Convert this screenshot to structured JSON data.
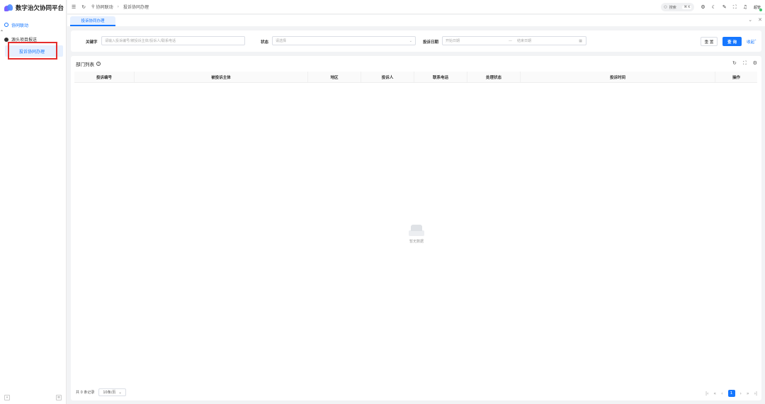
{
  "app": {
    "title": "数字治欠协同平台"
  },
  "sidebar": {
    "group": {
      "label": "协同联动"
    },
    "items": [
      {
        "label": "源头项目报送"
      },
      {
        "label": "投诉协同办理"
      }
    ]
  },
  "topbar": {
    "breadcrumb": [
      "协同联动",
      "投诉协同办理"
    ],
    "search": {
      "label": "搜索",
      "shortcut": "⌘ K"
    },
    "user": "超管"
  },
  "tabs": [
    {
      "label": "投诉协同办理"
    }
  ],
  "filters": {
    "keyword": {
      "label": "关键字",
      "placeholder": "请输入投诉编号/被投诉主体/投诉人/联系电话"
    },
    "status": {
      "label": "状态",
      "placeholder": "请选择"
    },
    "date": {
      "label": "投诉日期",
      "start_placeholder": "开始日期",
      "end_placeholder": "结束日期",
      "separator": "—"
    },
    "reset_label": "重 置",
    "query_label": "查 询",
    "collapse_label": "收起"
  },
  "table": {
    "title": "部门列表",
    "columns": [
      "投诉编号",
      "被投诉主体",
      "地区",
      "投诉人",
      "联系电话",
      "处理状态",
      "投诉时间",
      "操作"
    ],
    "empty_text": "暂无数据"
  },
  "pagination": {
    "total_text": "共 0 条记录",
    "page_size": "10条/页",
    "current_page": "1"
  },
  "colors": {
    "accent": "#1677ff",
    "highlight": "#e52e2e"
  }
}
